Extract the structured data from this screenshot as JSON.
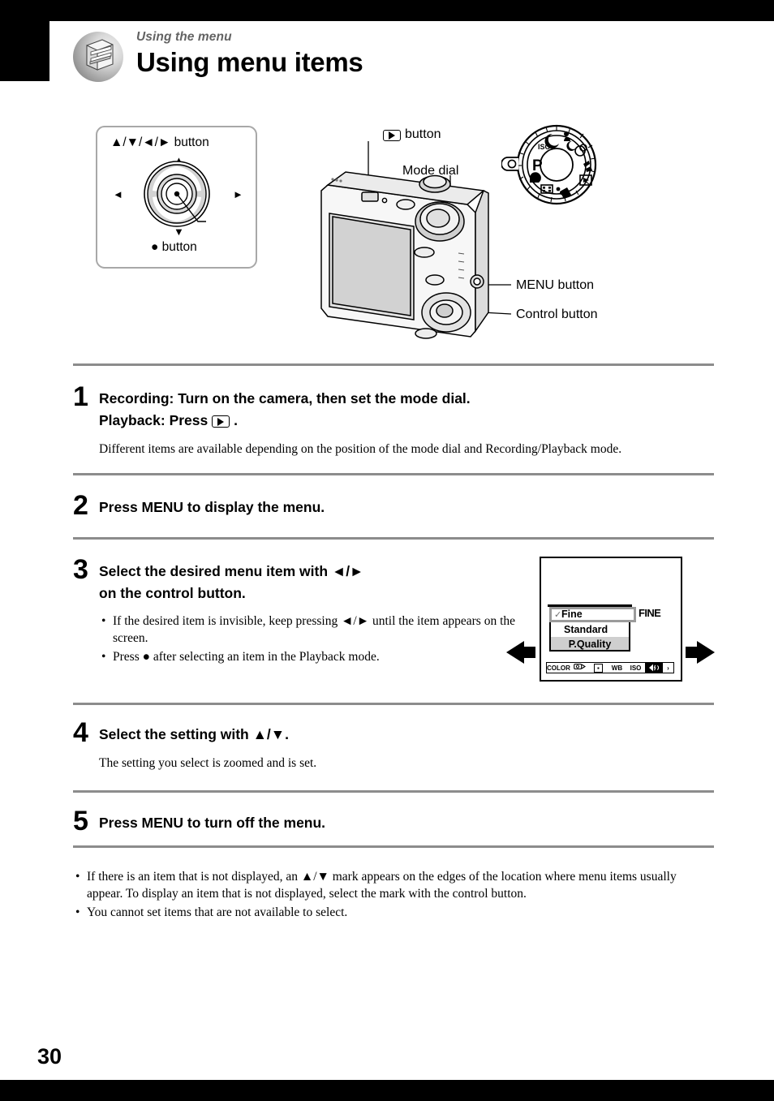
{
  "header": {
    "kicker": "Using the menu",
    "title": "Using menu items",
    "badge_icon": "menu-book-icon"
  },
  "figure": {
    "control_box": {
      "top_label": "▲/▼/◄/► button",
      "bottom_label": "● button",
      "up_glyph": "▲",
      "down_glyph": "▼",
      "left_glyph": "◄",
      "right_glyph": "►"
    },
    "camera_labels": {
      "playback_button": "button",
      "mode_dial": "Mode dial",
      "menu_button": "MENU button",
      "control_button": "Control button"
    }
  },
  "steps": [
    {
      "number": "1",
      "head_line1": "Recording: Turn on the camera, then set the mode dial.",
      "head_line2_prefix": "Playback: Press",
      "head_line2_suffix": ".",
      "note": "Different items are available depending on the position of the mode dial and Recording/Playback mode."
    },
    {
      "number": "2",
      "head_line1": "Press MENU to display the menu."
    },
    {
      "number": "3",
      "head_line1": "Select the desired menu item with ◄/►",
      "head_line2": "on the control button.",
      "bullets": [
        "If the desired item is invisible, keep pressing ◄/► until the item appears on the screen.",
        "Press ● after selecting an item in the Playback mode."
      ]
    },
    {
      "number": "4",
      "head_line1": "Select the setting with ▲/▼.",
      "note": "The setting you select is zoomed and is set."
    },
    {
      "number": "5",
      "head_line1": "Press MENU to turn off the menu."
    }
  ],
  "lcd": {
    "selected_row": "Fine",
    "check_glyph": "✓",
    "row_standard": "Standard",
    "row_pquality": "P.Quality",
    "fine_tag": "FINE",
    "bar_items": [
      "COLOR",
      "ev-icon",
      "metering-icon",
      "WB",
      "ISO",
      "flash-icon",
      "›"
    ],
    "bar_labels": {
      "color": "COLOR",
      "wb": "WB",
      "iso": "ISO",
      "more": "›"
    }
  },
  "footer_notes": [
    "If there is an item that is not displayed, an ▲/▼ mark appears on the edges of the location where menu items usually appear. To display an item that is not displayed, select the mark with the control button.",
    "You cannot set items that are not available to select."
  ],
  "page_number": "30"
}
